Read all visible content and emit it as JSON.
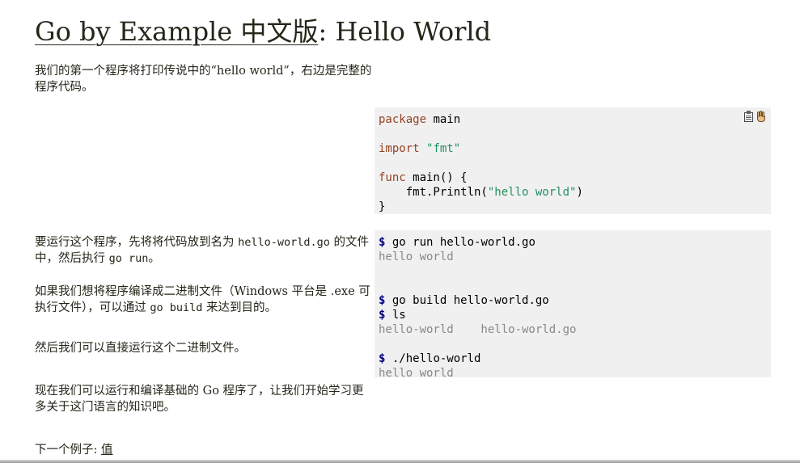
{
  "header": {
    "site_link": "Go by Example 中文版",
    "separator": ":",
    "page_title": "Hello World"
  },
  "intro": {
    "text": "我们的第一个程序将打印传说中的“hello world”，右边是完整的程序代码。"
  },
  "source": {
    "line1_kw": "package",
    "line1_rest": " main",
    "line2_kw": "import",
    "line2_str": "\"fmt\"",
    "line3_kw": "func",
    "line3_rest": " main() {",
    "line4_pre": "    fmt.Println(",
    "line4_str": "\"hello world\"",
    "line4_post": ")",
    "line5": "}"
  },
  "sections": [
    {
      "pre": "要运行这个程序，先将将代码放到名为 ",
      "code1": "hello-world.go",
      "mid": " 的文件中，然后执行 ",
      "code2": "go run",
      "post": "。"
    },
    {
      "pre": "如果我们想将程序编译成二进制文件（Windows 平台是 .exe 可执行文件），可以通过 ",
      "code1": "go build",
      "post": " 来达到目的。"
    },
    {
      "text": "然后我们可以直接运行这个二进制文件。"
    },
    {
      "text": "现在我们可以运行和编译基础的 Go 程序了，让我们开始学习更多关于这门语言的知识吧。"
    }
  ],
  "shell": {
    "prompt": "$",
    "cmd1": " go run hello-world.go",
    "out1": "hello world",
    "cmd2": " go build hello-world.go",
    "cmd3": " ls",
    "out3": "hello-world    hello-world.go",
    "cmd4": " ./hello-world",
    "out4": "hello world"
  },
  "icons": {
    "copy": "clipboard-icon",
    "run": "hand-icon"
  },
  "footer": {
    "next_label": "下一个例子: ",
    "next_link": "值"
  },
  "colors": {
    "keyword": "#954121",
    "string": "#219161",
    "prompt": "#000080",
    "output": "#888888",
    "code_bg": "#f0f0f0"
  }
}
